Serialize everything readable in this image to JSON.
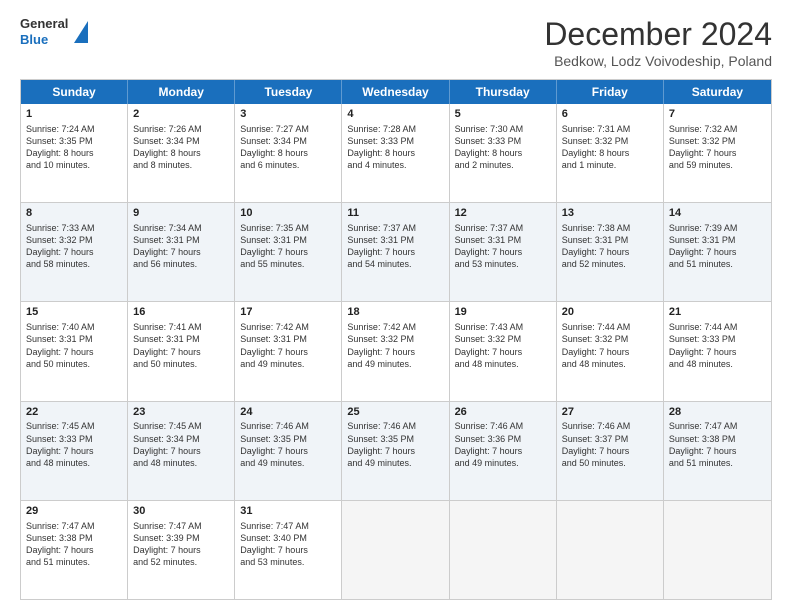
{
  "header": {
    "logo_line1": "General",
    "logo_line2": "Blue",
    "month_title": "December 2024",
    "subtitle": "Bedkow, Lodz Voivodeship, Poland"
  },
  "weekdays": [
    "Sunday",
    "Monday",
    "Tuesday",
    "Wednesday",
    "Thursday",
    "Friday",
    "Saturday"
  ],
  "rows": [
    [
      {
        "day": "1",
        "lines": [
          "Sunrise: 7:24 AM",
          "Sunset: 3:35 PM",
          "Daylight: 8 hours",
          "and 10 minutes."
        ],
        "shaded": false
      },
      {
        "day": "2",
        "lines": [
          "Sunrise: 7:26 AM",
          "Sunset: 3:34 PM",
          "Daylight: 8 hours",
          "and 8 minutes."
        ],
        "shaded": false
      },
      {
        "day": "3",
        "lines": [
          "Sunrise: 7:27 AM",
          "Sunset: 3:34 PM",
          "Daylight: 8 hours",
          "and 6 minutes."
        ],
        "shaded": false
      },
      {
        "day": "4",
        "lines": [
          "Sunrise: 7:28 AM",
          "Sunset: 3:33 PM",
          "Daylight: 8 hours",
          "and 4 minutes."
        ],
        "shaded": false
      },
      {
        "day": "5",
        "lines": [
          "Sunrise: 7:30 AM",
          "Sunset: 3:33 PM",
          "Daylight: 8 hours",
          "and 2 minutes."
        ],
        "shaded": false
      },
      {
        "day": "6",
        "lines": [
          "Sunrise: 7:31 AM",
          "Sunset: 3:32 PM",
          "Daylight: 8 hours",
          "and 1 minute."
        ],
        "shaded": false
      },
      {
        "day": "7",
        "lines": [
          "Sunrise: 7:32 AM",
          "Sunset: 3:32 PM",
          "Daylight: 7 hours",
          "and 59 minutes."
        ],
        "shaded": false
      }
    ],
    [
      {
        "day": "8",
        "lines": [
          "Sunrise: 7:33 AM",
          "Sunset: 3:32 PM",
          "Daylight: 7 hours",
          "and 58 minutes."
        ],
        "shaded": true
      },
      {
        "day": "9",
        "lines": [
          "Sunrise: 7:34 AM",
          "Sunset: 3:31 PM",
          "Daylight: 7 hours",
          "and 56 minutes."
        ],
        "shaded": true
      },
      {
        "day": "10",
        "lines": [
          "Sunrise: 7:35 AM",
          "Sunset: 3:31 PM",
          "Daylight: 7 hours",
          "and 55 minutes."
        ],
        "shaded": true
      },
      {
        "day": "11",
        "lines": [
          "Sunrise: 7:37 AM",
          "Sunset: 3:31 PM",
          "Daylight: 7 hours",
          "and 54 minutes."
        ],
        "shaded": true
      },
      {
        "day": "12",
        "lines": [
          "Sunrise: 7:37 AM",
          "Sunset: 3:31 PM",
          "Daylight: 7 hours",
          "and 53 minutes."
        ],
        "shaded": true
      },
      {
        "day": "13",
        "lines": [
          "Sunrise: 7:38 AM",
          "Sunset: 3:31 PM",
          "Daylight: 7 hours",
          "and 52 minutes."
        ],
        "shaded": true
      },
      {
        "day": "14",
        "lines": [
          "Sunrise: 7:39 AM",
          "Sunset: 3:31 PM",
          "Daylight: 7 hours",
          "and 51 minutes."
        ],
        "shaded": true
      }
    ],
    [
      {
        "day": "15",
        "lines": [
          "Sunrise: 7:40 AM",
          "Sunset: 3:31 PM",
          "Daylight: 7 hours",
          "and 50 minutes."
        ],
        "shaded": false
      },
      {
        "day": "16",
        "lines": [
          "Sunrise: 7:41 AM",
          "Sunset: 3:31 PM",
          "Daylight: 7 hours",
          "and 50 minutes."
        ],
        "shaded": false
      },
      {
        "day": "17",
        "lines": [
          "Sunrise: 7:42 AM",
          "Sunset: 3:31 PM",
          "Daylight: 7 hours",
          "and 49 minutes."
        ],
        "shaded": false
      },
      {
        "day": "18",
        "lines": [
          "Sunrise: 7:42 AM",
          "Sunset: 3:32 PM",
          "Daylight: 7 hours",
          "and 49 minutes."
        ],
        "shaded": false
      },
      {
        "day": "19",
        "lines": [
          "Sunrise: 7:43 AM",
          "Sunset: 3:32 PM",
          "Daylight: 7 hours",
          "and 48 minutes."
        ],
        "shaded": false
      },
      {
        "day": "20",
        "lines": [
          "Sunrise: 7:44 AM",
          "Sunset: 3:32 PM",
          "Daylight: 7 hours",
          "and 48 minutes."
        ],
        "shaded": false
      },
      {
        "day": "21",
        "lines": [
          "Sunrise: 7:44 AM",
          "Sunset: 3:33 PM",
          "Daylight: 7 hours",
          "and 48 minutes."
        ],
        "shaded": false
      }
    ],
    [
      {
        "day": "22",
        "lines": [
          "Sunrise: 7:45 AM",
          "Sunset: 3:33 PM",
          "Daylight: 7 hours",
          "and 48 minutes."
        ],
        "shaded": true
      },
      {
        "day": "23",
        "lines": [
          "Sunrise: 7:45 AM",
          "Sunset: 3:34 PM",
          "Daylight: 7 hours",
          "and 48 minutes."
        ],
        "shaded": true
      },
      {
        "day": "24",
        "lines": [
          "Sunrise: 7:46 AM",
          "Sunset: 3:35 PM",
          "Daylight: 7 hours",
          "and 49 minutes."
        ],
        "shaded": true
      },
      {
        "day": "25",
        "lines": [
          "Sunrise: 7:46 AM",
          "Sunset: 3:35 PM",
          "Daylight: 7 hours",
          "and 49 minutes."
        ],
        "shaded": true
      },
      {
        "day": "26",
        "lines": [
          "Sunrise: 7:46 AM",
          "Sunset: 3:36 PM",
          "Daylight: 7 hours",
          "and 49 minutes."
        ],
        "shaded": true
      },
      {
        "day": "27",
        "lines": [
          "Sunrise: 7:46 AM",
          "Sunset: 3:37 PM",
          "Daylight: 7 hours",
          "and 50 minutes."
        ],
        "shaded": true
      },
      {
        "day": "28",
        "lines": [
          "Sunrise: 7:47 AM",
          "Sunset: 3:38 PM",
          "Daylight: 7 hours",
          "and 51 minutes."
        ],
        "shaded": true
      }
    ],
    [
      {
        "day": "29",
        "lines": [
          "Sunrise: 7:47 AM",
          "Sunset: 3:38 PM",
          "Daylight: 7 hours",
          "and 51 minutes."
        ],
        "shaded": false
      },
      {
        "day": "30",
        "lines": [
          "Sunrise: 7:47 AM",
          "Sunset: 3:39 PM",
          "Daylight: 7 hours",
          "and 52 minutes."
        ],
        "shaded": false
      },
      {
        "day": "31",
        "lines": [
          "Sunrise: 7:47 AM",
          "Sunset: 3:40 PM",
          "Daylight: 7 hours",
          "and 53 minutes."
        ],
        "shaded": false
      },
      {
        "day": "",
        "lines": [],
        "shaded": false,
        "empty": true
      },
      {
        "day": "",
        "lines": [],
        "shaded": false,
        "empty": true
      },
      {
        "day": "",
        "lines": [],
        "shaded": false,
        "empty": true
      },
      {
        "day": "",
        "lines": [],
        "shaded": false,
        "empty": true
      }
    ]
  ]
}
